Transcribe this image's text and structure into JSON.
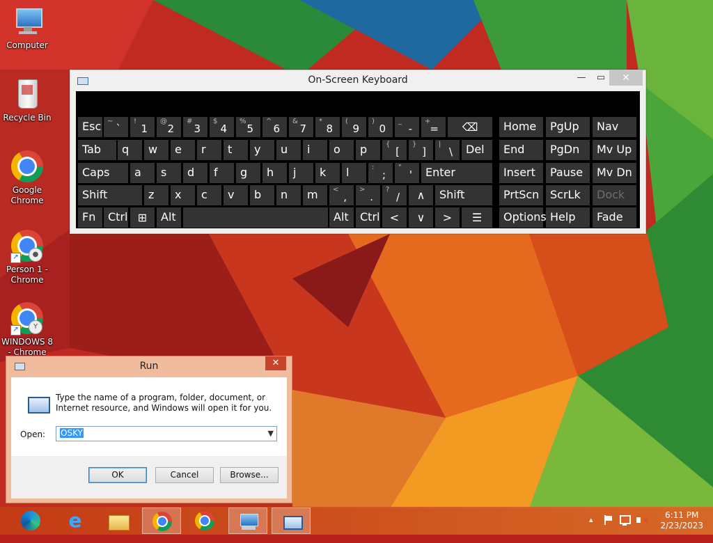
{
  "desktop": {
    "icons": [
      {
        "label": "Computer",
        "icon": "computer-icon"
      },
      {
        "label": "Recycle Bin",
        "icon": "recycle-bin-icon"
      },
      {
        "label": "Google Chrome",
        "icon": "chrome-icon"
      },
      {
        "label": "Person 1 - Chrome",
        "icon": "chrome-profile-icon"
      },
      {
        "label": "WINDOWS 8 - Chrome",
        "icon": "chrome-profile-icon"
      }
    ]
  },
  "osk": {
    "title": "On-Screen Keyboard",
    "controls": {
      "minimize": "—",
      "maximize": "▭",
      "close": "✕"
    },
    "keys": {
      "row1": [
        {
          "main": "Esc"
        },
        {
          "shift": "~",
          "low": "`"
        },
        {
          "shift": "!",
          "low": "1"
        },
        {
          "shift": "@",
          "low": "2"
        },
        {
          "shift": "#",
          "low": "3"
        },
        {
          "shift": "$",
          "low": "4"
        },
        {
          "shift": "%",
          "low": "5"
        },
        {
          "shift": "^",
          "low": "6"
        },
        {
          "shift": "&",
          "low": "7"
        },
        {
          "shift": "*",
          "low": "8"
        },
        {
          "shift": "(",
          "low": "9"
        },
        {
          "shift": ")",
          "low": "0"
        },
        {
          "shift": "_",
          "low": "-"
        },
        {
          "shift": "+",
          "low": "="
        },
        {
          "main": "⌫"
        }
      ],
      "row2": [
        {
          "main": "Tab"
        },
        {
          "main": "q"
        },
        {
          "main": "w"
        },
        {
          "main": "e"
        },
        {
          "main": "r"
        },
        {
          "main": "t"
        },
        {
          "main": "y"
        },
        {
          "main": "u"
        },
        {
          "main": "i"
        },
        {
          "main": "o"
        },
        {
          "main": "p"
        },
        {
          "shift": "{",
          "low": "["
        },
        {
          "shift": "}",
          "low": "]"
        },
        {
          "shift": "|",
          "low": "\\"
        },
        {
          "main": "Del"
        }
      ],
      "row3": [
        {
          "main": "Caps"
        },
        {
          "main": "a"
        },
        {
          "main": "s"
        },
        {
          "main": "d"
        },
        {
          "main": "f"
        },
        {
          "main": "g"
        },
        {
          "main": "h"
        },
        {
          "main": "j"
        },
        {
          "main": "k"
        },
        {
          "main": "l"
        },
        {
          "shift": ":",
          "low": ";"
        },
        {
          "shift": "\"",
          "low": "'"
        },
        {
          "main": "Enter"
        }
      ],
      "row4": [
        {
          "main": "Shift"
        },
        {
          "main": "z"
        },
        {
          "main": "x"
        },
        {
          "main": "c"
        },
        {
          "main": "v"
        },
        {
          "main": "b"
        },
        {
          "main": "n"
        },
        {
          "main": "m"
        },
        {
          "shift": "<",
          "low": ","
        },
        {
          "shift": ">",
          "low": "."
        },
        {
          "shift": "?",
          "low": "/"
        },
        {
          "main": "∧"
        },
        {
          "main": "Shift"
        }
      ],
      "row5": [
        {
          "main": "Fn"
        },
        {
          "main": "Ctrl"
        },
        {
          "main": "⊞"
        },
        {
          "main": "Alt"
        },
        {
          "main": ""
        },
        {
          "main": "Alt"
        },
        {
          "main": "Ctrl"
        },
        {
          "main": "<"
        },
        {
          "main": "∨"
        },
        {
          "main": ">"
        },
        {
          "main": "☰"
        }
      ],
      "nav": [
        {
          "main": "Home"
        },
        {
          "main": "PgUp"
        },
        {
          "main": "Nav"
        },
        {
          "main": "End"
        },
        {
          "main": "PgDn"
        },
        {
          "main": "Mv Up"
        },
        {
          "main": "Insert"
        },
        {
          "main": "Pause"
        },
        {
          "main": "Mv Dn"
        },
        {
          "main": "PrtScn"
        },
        {
          "main": "ScrLk"
        },
        {
          "main": "Dock"
        },
        {
          "main": "Options"
        },
        {
          "main": "Help"
        },
        {
          "main": "Fade"
        }
      ]
    }
  },
  "run": {
    "title": "Run",
    "close": "✕",
    "description": "Type the name of a program, folder, document, or Internet resource, and Windows will open it for you.",
    "open_label": "Open:",
    "open_value": "OSKY",
    "ok": "OK",
    "cancel": "Cancel",
    "browse": "Browse..."
  },
  "taskbar": {
    "items": [
      "edge-icon",
      "internet-explorer-icon",
      "file-explorer-icon",
      "chrome-icon",
      "chrome-icon",
      "computer-icon",
      "run-icon"
    ],
    "tray": {
      "expand": "▴",
      "time": "6:11 PM",
      "date": "2/23/2023"
    }
  },
  "colors": {
    "taskbar": "#c43c14",
    "run_frame": "#f1bb9d",
    "osk_key": "#333333",
    "selection": "#3399ff"
  }
}
